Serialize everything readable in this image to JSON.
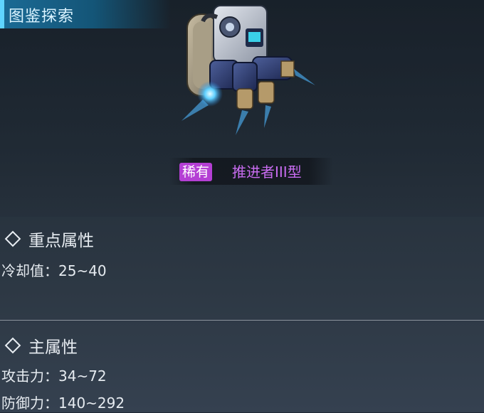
{
  "header": {
    "title": "图鉴探索"
  },
  "item": {
    "rarity": "稀有",
    "name": "推进者III型"
  },
  "sections": {
    "key": {
      "title": "重点属性",
      "stats": [
        "冷却值：25~40"
      ]
    },
    "main": {
      "title": "主属性",
      "stats": [
        "攻击力：34~72",
        "防御力：140~292"
      ]
    }
  },
  "colors": {
    "rarity_badge": "#b43fd4",
    "item_name": "#c86cf0",
    "banner": "#1b6b96"
  },
  "icons": {
    "section_marker": "diamond-icon"
  }
}
